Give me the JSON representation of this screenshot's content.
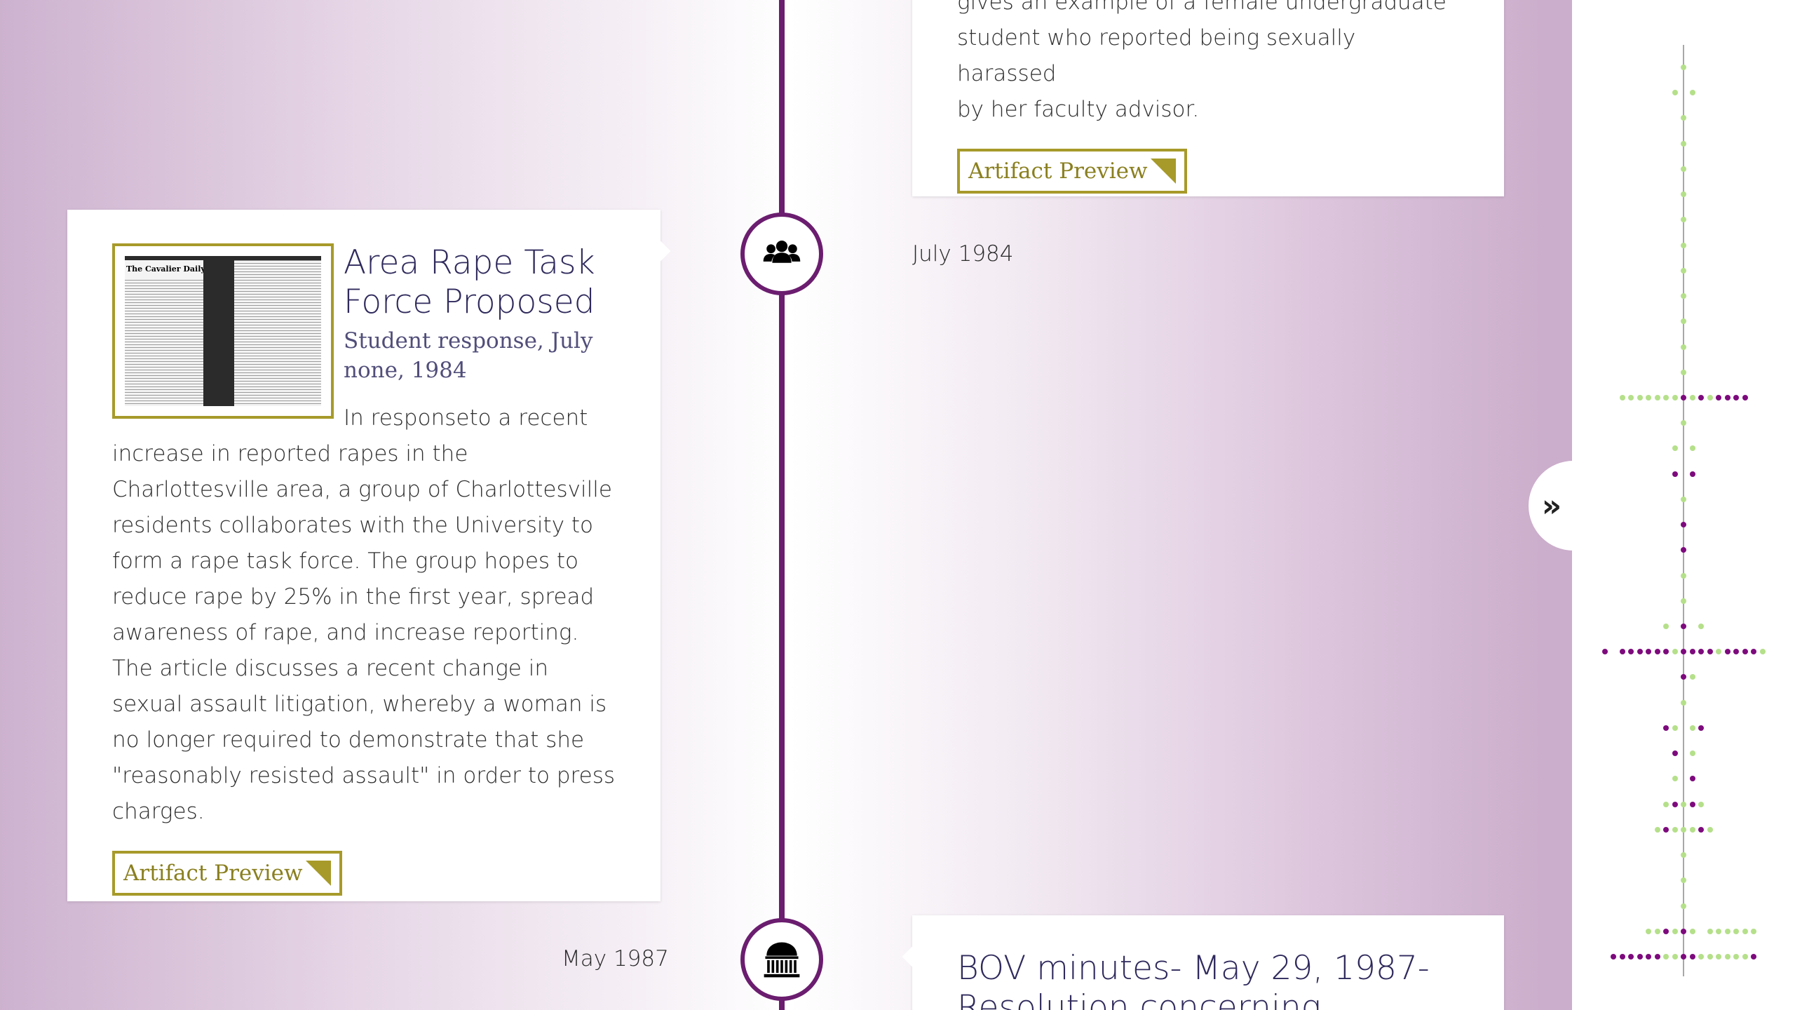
{
  "colors": {
    "timeline": "#6b1d6f",
    "accent_gold": "#a79a2a",
    "title_navy": "#2f2a5c",
    "dot_green": "#b5e08a",
    "dot_purple": "#7d0a7d",
    "dot_olive": "#7a7a20"
  },
  "top_card": {
    "line_partial": "gives an example of a female undergraduate",
    "line2": "student who reported being sexually harassed",
    "line3": "by her faculty advisor.",
    "button_label": "Artifact Preview"
  },
  "event_1984": {
    "date": "July 1984",
    "node_icon": "users-icon",
    "thumbnail_masthead": "The Cavalier Daily",
    "title": "Area Rape Task Force Proposed",
    "subtitle": "Student response, July none, 1984",
    "text": "In responseto a recent increase in reported rapes in the Charlottesville area, a group of Charlottesville residents collaborates with the University to form a rape task force. The group hopes to reduce rape by 25% in the first year, spread awareness of rape, and increase reporting. The article discusses a recent change in sexual assault litigation, whereby a woman is no longer required to demonstrate that she \"reasonably resisted assault\" in order to press charges.",
    "button_label": "Artifact Preview"
  },
  "event_1987": {
    "date": "May 1987",
    "node_icon": "rotunda-icon",
    "title_line1": "BOV minutes- May 29, 1987-",
    "title_line2_partial": "Resolution concerning"
  },
  "sidebar": {
    "toggle_label": "»",
    "dot_rows": [
      {
        "g": [
          0
        ],
        "p": []
      },
      {
        "g": [
          -1,
          1
        ],
        "p": []
      },
      {
        "g": [
          0
        ],
        "p": []
      },
      {
        "g": [
          0
        ],
        "p": []
      },
      {
        "g": [
          0
        ],
        "p": []
      },
      {
        "g": [
          0
        ],
        "p": []
      },
      {
        "g": [
          0
        ],
        "p": []
      },
      {
        "g": [
          0
        ],
        "p": []
      },
      {
        "g": [
          0
        ],
        "p": []
      },
      {
        "g": [
          0
        ],
        "p": []
      },
      {
        "g": [
          0
        ],
        "p": []
      },
      {
        "g": [
          0
        ],
        "p": []
      },
      {
        "g": [
          0
        ],
        "p": []
      },
      {
        "g": [
          -7,
          -6,
          -5,
          -4,
          -3,
          -2,
          -1,
          1,
          3
        ],
        "p": [
          0,
          2,
          4,
          5,
          6,
          7
        ]
      },
      {
        "g": [
          0
        ],
        "p": []
      },
      {
        "g": [
          -1,
          1
        ],
        "p": []
      },
      {
        "g": [],
        "p": [
          -1,
          1
        ]
      },
      {
        "g": [
          0
        ],
        "p": []
      },
      {
        "g": [],
        "p": [
          0
        ]
      },
      {
        "g": [],
        "p": [
          0
        ]
      },
      {
        "g": [
          0
        ],
        "p": []
      },
      {
        "g": [
          0
        ],
        "p": []
      },
      {
        "g": [
          -2,
          2
        ],
        "p": [
          0
        ]
      },
      {
        "g": [
          -1,
          4,
          9
        ],
        "p": [
          -9,
          -7,
          -6,
          -5,
          -4,
          -3,
          -2,
          0,
          1,
          2,
          3,
          5,
          6,
          7,
          8
        ]
      },
      {
        "g": [
          1
        ],
        "p": [
          0
        ]
      },
      {
        "g": [
          0
        ],
        "p": []
      },
      {
        "g": [
          -1,
          1
        ],
        "p": [
          -2,
          2
        ]
      },
      {
        "g": [
          1
        ],
        "p": [
          -1
        ]
      },
      {
        "g": [
          -1
        ],
        "p": [
          1
        ]
      },
      {
        "g": [
          -2,
          0,
          2
        ],
        "p": [
          -1,
          1
        ]
      },
      {
        "g": [
          -3,
          -1,
          0,
          1,
          3
        ],
        "p": [
          -2,
          2
        ]
      },
      {
        "g": [
          0
        ],
        "p": []
      },
      {
        "g": [
          0
        ],
        "p": []
      },
      {
        "g": [
          0
        ],
        "p": []
      },
      {
        "g": [
          -4,
          -3,
          -1,
          1,
          3,
          4,
          5,
          6,
          7,
          8
        ],
        "p": [
          0,
          -2
        ]
      },
      {
        "g": [
          -2,
          -1,
          2,
          3,
          4,
          5,
          6,
          7
        ],
        "p": [
          -8,
          -7,
          -6,
          -5,
          -4,
          -3,
          0,
          1,
          8
        ]
      }
    ]
  }
}
